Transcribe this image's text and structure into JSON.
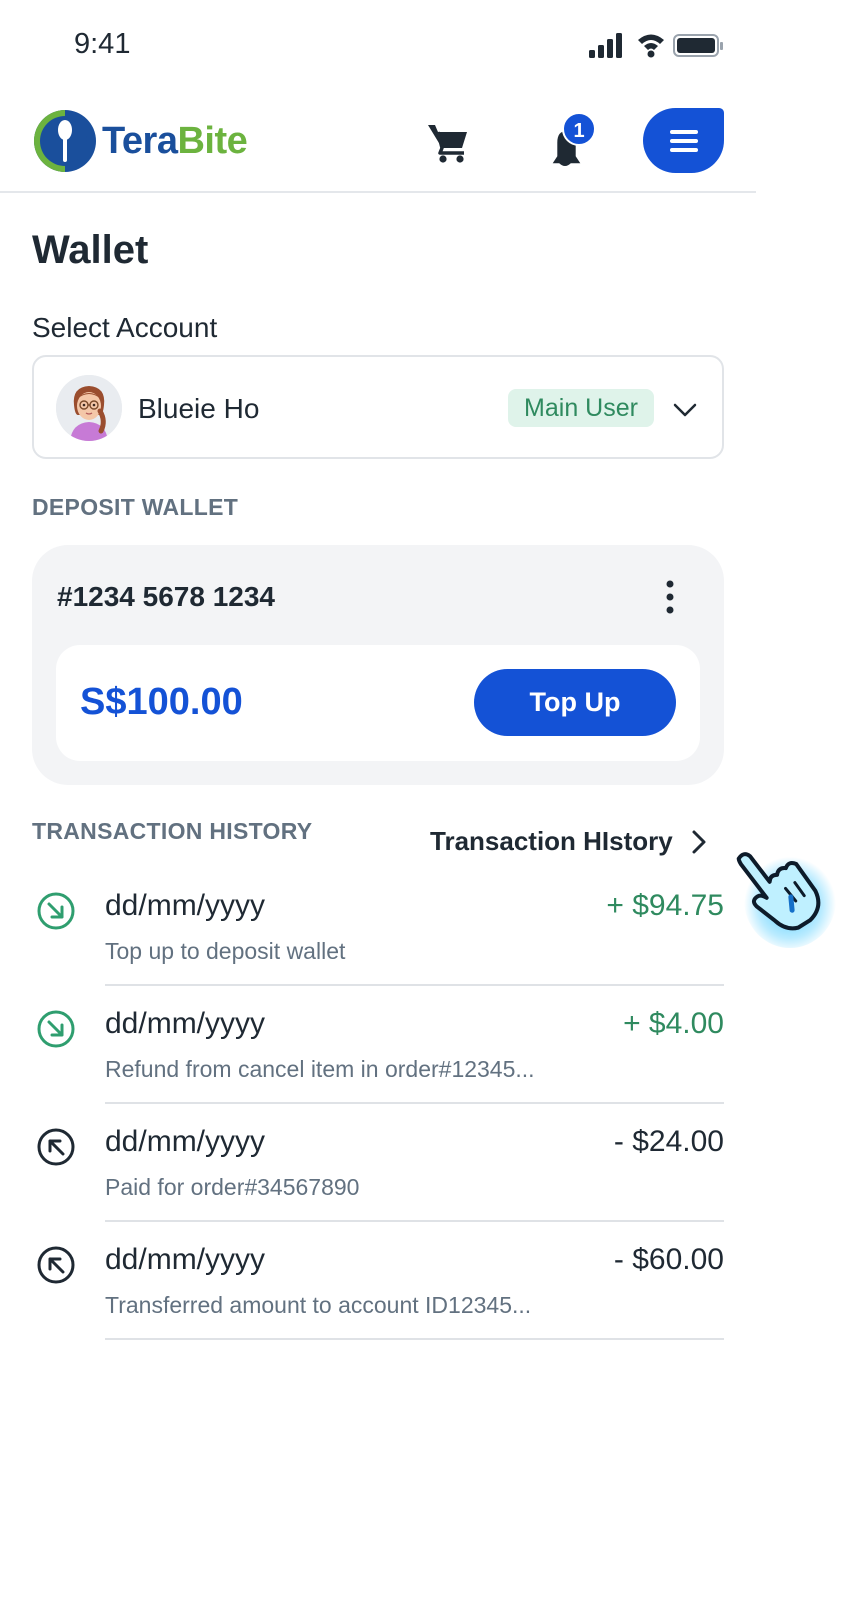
{
  "status_bar": {
    "time": "9:41"
  },
  "header": {
    "logo_part1": "Tera",
    "logo_part2": "Bite",
    "notification_count": "1",
    "brand_color": "#1452d6"
  },
  "page": {
    "title": "Wallet"
  },
  "account": {
    "label": "Select Account",
    "name": "Blueie Ho",
    "role_badge": "Main User"
  },
  "deposit_wallet": {
    "section_label": "DEPOSIT WALLET",
    "number": "#1234 5678 1234",
    "balance": "S$100.00",
    "topup_label": "Top Up"
  },
  "transactions": {
    "section_label": "TRANSACTION HISTORY",
    "link_label": "Transaction HIstory",
    "items": [
      {
        "date": "dd/mm/yyyy",
        "amount": "+ $94.75",
        "description": "Top up to deposit wallet",
        "direction": "in"
      },
      {
        "date": "dd/mm/yyyy",
        "amount": "+ $4.00",
        "description": "Refund from cancel item in order#12345...",
        "direction": "in"
      },
      {
        "date": "dd/mm/yyyy",
        "amount": "- $24.00",
        "description": "Paid for order#34567890",
        "direction": "out"
      },
      {
        "date": "dd/mm/yyyy",
        "amount": "- $60.00",
        "description": "Transferred amount to account ID12345...",
        "direction": "out"
      }
    ]
  },
  "colors": {
    "incoming": "#2f8a5f",
    "outgoing": "#1f2933",
    "accent": "#1452d6"
  }
}
